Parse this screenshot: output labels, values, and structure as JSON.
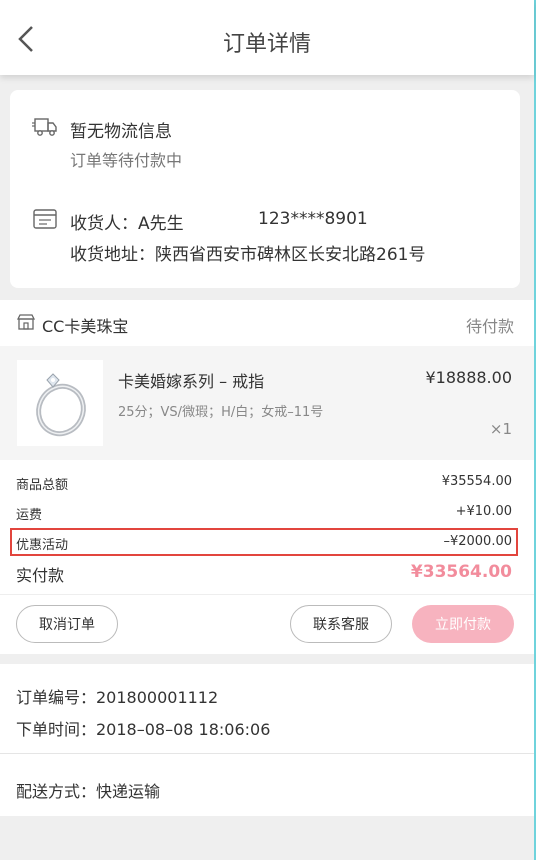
{
  "header": {
    "title": "订单详情"
  },
  "logistics": {
    "status": "暂无物流信息",
    "sub_status": "订单等待付款中"
  },
  "receiver": {
    "name_label": "收货人：A先生",
    "phone": "123****8901",
    "address_label": "收货地址：陕西省西安市碑林区长安北路261号"
  },
  "shop": {
    "name": "CC卡美珠宝",
    "status": "待付款"
  },
  "product": {
    "name": "卡美婚嫁系列 – 戒指",
    "spec": "25分；VS/微瑕；H/白；女戒–11号",
    "price": "¥18888.00",
    "qty": "×1"
  },
  "summary": {
    "goods_total_label": "商品总额",
    "goods_total_value": "¥35554.00",
    "freight_label": "运费",
    "freight_value": "+¥10.00",
    "discount_label": "优惠活动",
    "discount_value": "–¥2000.00",
    "paid_label": "实付款",
    "paid_value": "¥33564.00"
  },
  "actions": {
    "cancel": "取消订单",
    "service": "联系客服",
    "pay": "立即付款"
  },
  "order_info": {
    "order_no": "订单编号：201800001112",
    "order_time": "下单时间：2018–08–08 18:06:06",
    "delivery": "配送方式：快递运输"
  },
  "colors": {
    "accent_pink": "#f28c9c",
    "pay_button": "#f7b3bf",
    "highlight_border": "#e2453d"
  }
}
